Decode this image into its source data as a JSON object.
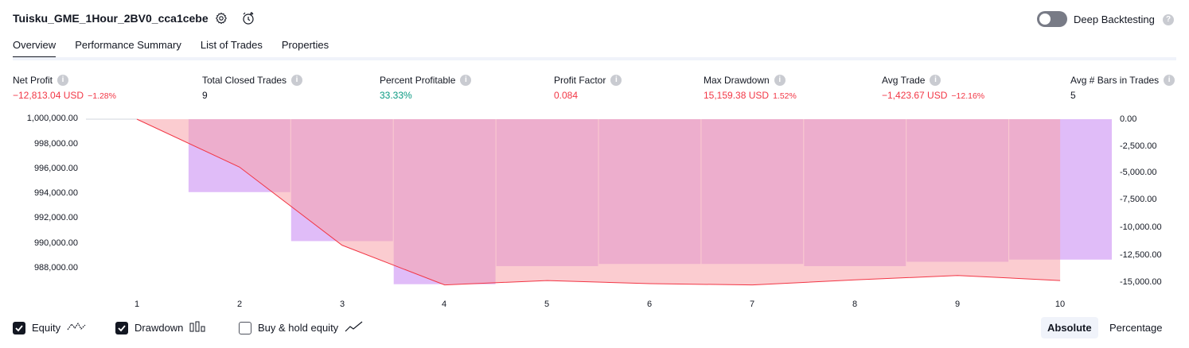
{
  "header": {
    "title": "Tuisku_GME_1Hour_2BV0_cca1cebe",
    "deep_backtesting_label": "Deep Backtesting",
    "deep_backtesting_enabled": false
  },
  "tabs": [
    {
      "label": "Overview",
      "active": true
    },
    {
      "label": "Performance Summary",
      "active": false
    },
    {
      "label": "List of Trades",
      "active": false
    },
    {
      "label": "Properties",
      "active": false
    }
  ],
  "metrics": [
    {
      "label": "Net Profit",
      "value": "−12,813.04 USD",
      "pct": "−1.28%",
      "color": "#f23645"
    },
    {
      "label": "Total Closed Trades",
      "value": "9",
      "pct": "",
      "color": "#131722"
    },
    {
      "label": "Percent Profitable",
      "value": "33.33%",
      "pct": "",
      "color": "#089981"
    },
    {
      "label": "Profit Factor",
      "value": "0.084",
      "pct": "",
      "color": "#f23645"
    },
    {
      "label": "Max Drawdown",
      "value": "15,159.38 USD",
      "pct": "1.52%",
      "color": "#f23645"
    },
    {
      "label": "Avg Trade",
      "value": "−1,423.67 USD",
      "pct": "−12.16%",
      "color": "#f23645"
    },
    {
      "label": "Avg # Bars in Trades",
      "value": "5",
      "pct": "",
      "color": "#131722"
    }
  ],
  "chart_data": {
    "type": "line+bar",
    "x": [
      1,
      2,
      3,
      4,
      5,
      6,
      7,
      8,
      9,
      10
    ],
    "x_tick_labels": [
      "1",
      "2",
      "3",
      "4",
      "5",
      "6",
      "7",
      "8",
      "9",
      "10"
    ],
    "y_left_ticks": [
      "1,000,000.00",
      "998,000.00",
      "996,000.00",
      "994,000.00",
      "992,000.00",
      "990,000.00",
      "988,000.00"
    ],
    "y_right_ticks": [
      "0.00",
      "-2,500.00",
      "-5,000.00",
      "-7,500.00",
      "-10,000.00",
      "-12,500.00",
      "-15,000.00"
    ],
    "ylim_left": [
      986700,
      1000000
    ],
    "ylim_right": [
      -15400,
      0
    ],
    "series": [
      {
        "name": "Equity",
        "values": [
          1000000,
          996200,
          990000,
          986850,
          987200,
          986950,
          986850,
          987250,
          987600,
          987200
        ]
      },
      {
        "name": "Drawdown",
        "values": [
          0,
          -6700,
          -11200,
          -15159,
          -13500,
          -13300,
          -13300,
          -13500,
          -13100,
          -12900
        ]
      }
    ],
    "colors": {
      "equity_line": "#f23645",
      "drawdown": "#d6a6f5",
      "equity_fill": "#f7a3a9"
    }
  },
  "legend": [
    {
      "label": "Equity",
      "checked": true,
      "icon": "equity-line-icon"
    },
    {
      "label": "Drawdown",
      "checked": true,
      "icon": "drawdown-bars-icon"
    },
    {
      "label": "Buy & hold equity",
      "checked": false,
      "icon": "buy-hold-line-icon"
    }
  ],
  "scale_buttons": {
    "absolute": "Absolute",
    "percentage": "Percentage",
    "active": "absolute"
  }
}
